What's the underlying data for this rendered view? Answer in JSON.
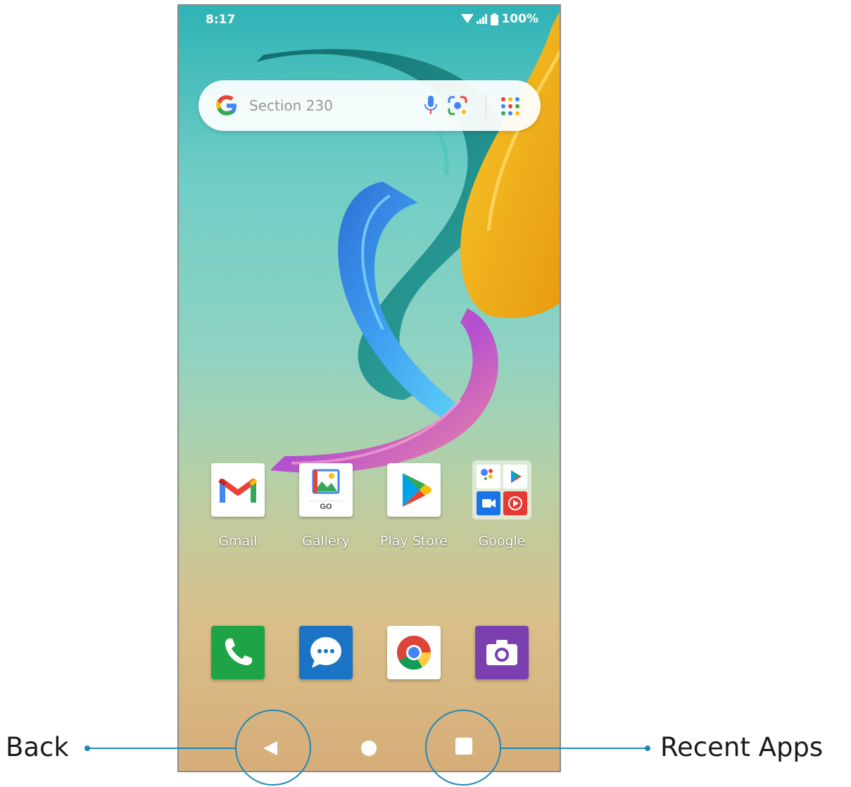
{
  "status_bar": {
    "time": "8:17",
    "battery": "100%"
  },
  "search": {
    "placeholder": "Section 230"
  },
  "apps": [
    {
      "label": "Gmail",
      "icon": "gmail-icon"
    },
    {
      "label": "Gallery",
      "icon": "gallery-go-icon",
      "badge": "GO"
    },
    {
      "label": "Play Store",
      "icon": "play-store-icon"
    },
    {
      "label": "Google",
      "icon": "google-folder-icon"
    }
  ],
  "dock": [
    {
      "icon": "phone-icon",
      "color": "#1ea446"
    },
    {
      "icon": "messages-icon",
      "color": "#1a73c4"
    },
    {
      "icon": "chrome-icon",
      "color": "#ffffff"
    },
    {
      "icon": "camera-icon",
      "color": "#7b3fb0"
    }
  ],
  "nav": {
    "back_icon": "back-triangle-icon",
    "home_icon": "home-circle-icon",
    "recent_icon": "recent-square-icon"
  },
  "callouts": {
    "back": "Back",
    "recent": "Recent Apps"
  },
  "colors": {
    "callout": "#1e88b8"
  }
}
